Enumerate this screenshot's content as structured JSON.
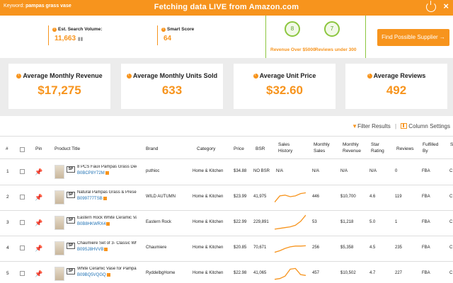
{
  "topbar": {
    "keyword_label": "Keyword:",
    "keyword_value": "pampas grass vase",
    "title": "Fetching data LIVE from Amazon.com",
    "close": "×"
  },
  "summary": {
    "search_volume_label": "Est. Search Volume:",
    "search_volume_value": "11,663",
    "smart_score_label": "Smart Score",
    "smart_score_value": "64",
    "revenue_over_count": "8",
    "revenue_over_label": "Revenue Over $5000",
    "reviews_under_count": "7",
    "reviews_under_label": "Reviews under 300",
    "find_supplier_label": "Find Possible Supplier",
    "find_supplier_arrow": "→"
  },
  "cards": [
    {
      "label": "Average Monthly Revenue",
      "value": "$17,275"
    },
    {
      "label": "Average Monthly Units Sold",
      "value": "633"
    },
    {
      "label": "Average Unit Price",
      "value": "$32.60"
    },
    {
      "label": "Average Reviews",
      "value": "492"
    }
  ],
  "tools": {
    "filter_label": "Filter Results",
    "columns_label": "Column Settings"
  },
  "table": {
    "headers": {
      "num": "#",
      "pin": "Pin",
      "title": "Product Title",
      "brand": "Brand",
      "category": "Category",
      "price": "Price",
      "bsr": "BSR",
      "history": "Sales History",
      "msales": "Monthly Sales",
      "mrev": "Monthly Revenue",
      "star": "Star Rating",
      "reviews": "Reviews",
      "fulfilled": "Fulfilled By",
      "s": "S"
    },
    "rows": [
      {
        "num": "1",
        "title": "8 PCS Faux Pampas Grass Decor...",
        "asin": "B0BCP8Y72M",
        "brand": "puthioc",
        "category": "Home & Kitchen",
        "price": "$34.88",
        "bsr": "NO BSR",
        "history": "N/A",
        "msales": "N/A",
        "mrev": "N/A",
        "star": "N/A",
        "reviews": "0",
        "fulfilled": "FBA",
        "s": "C",
        "spark": []
      },
      {
        "num": "2",
        "title": "Natural Pampas Grass & Preserve...",
        "asin": "B099777TSB",
        "brand": "WILD AUTUMN",
        "category": "Home & Kitchen",
        "price": "$23.99",
        "bsr": "41,975",
        "history": "",
        "msales": "446",
        "mrev": "$10,700",
        "star": "4.6",
        "reviews": "119",
        "fulfilled": "FBA",
        "s": "C",
        "spark": [
          0.15,
          0.55,
          0.6,
          0.5,
          0.55,
          0.7,
          0.75
        ]
      },
      {
        "num": "3",
        "title": "Eastern Rock White Ceramic Vase...",
        "asin": "B0B8HKWRX4",
        "brand": "Eastern Rock",
        "category": "Home & Kitchen",
        "price": "$22.99",
        "bsr": "229,891",
        "history": "",
        "msales": "53",
        "mrev": "$1,218",
        "star": "5.0",
        "reviews": "1",
        "fulfilled": "FBA",
        "s": "C",
        "spark": [
          0.05,
          0.1,
          0.15,
          0.2,
          0.3,
          0.55,
          0.95
        ]
      },
      {
        "num": "4",
        "title": "Chaumiere Set of 3- Classic White...",
        "asin": "B09SJ8HVVB",
        "brand": "Chaumiere",
        "category": "Home & Kitchen",
        "price": "$20.85",
        "bsr": "70,671",
        "history": "",
        "msales": "256",
        "mrev": "$5,358",
        "star": "4.5",
        "reviews": "235",
        "fulfilled": "FBA",
        "s": "C",
        "spark": [
          0.2,
          0.3,
          0.45,
          0.55,
          0.6,
          0.6,
          0.62
        ]
      },
      {
        "num": "5",
        "title": "White Ceramic Vase for Pampas...",
        "asin": "B09BQ5VQGQ",
        "brand": "RyddelbgHome",
        "category": "Home & Kitchen",
        "price": "$22.98",
        "bsr": "41,065",
        "history": "",
        "msales": "457",
        "mrev": "$10,502",
        "star": "4.7",
        "reviews": "227",
        "fulfilled": "FBA",
        "s": "C",
        "spark": [
          0.1,
          0.15,
          0.3,
          0.75,
          0.8,
          0.4,
          0.35
        ]
      }
    ]
  },
  "colors": {
    "accent": "#f7941d",
    "green": "#8cc63f",
    "link": "#1b6fb3"
  }
}
